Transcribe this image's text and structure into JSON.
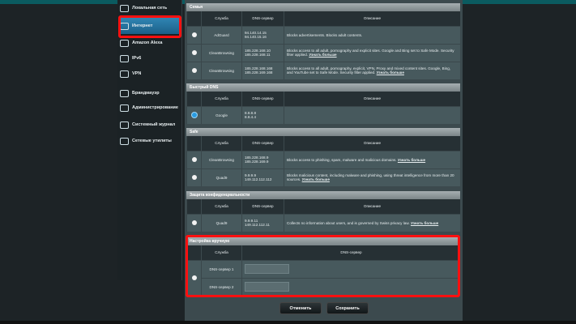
{
  "sidebar": {
    "items": [
      {
        "label": "Локальная сеть",
        "icon": "lan-icon"
      },
      {
        "label": "Интернет",
        "icon": "globe-icon",
        "active": true
      },
      {
        "label": "Amazon Alexa",
        "icon": "alexa-icon"
      },
      {
        "label": "IPv6",
        "icon": "ipv6-icon"
      },
      {
        "label": "VPN",
        "icon": "vpn-icon"
      },
      {
        "label": "Брандмауэр",
        "icon": "firewall-icon"
      },
      {
        "label": "Администрирование",
        "icon": "admin-icon"
      },
      {
        "label": "Системный журнал",
        "icon": "log-icon"
      },
      {
        "label": "Сетевые утилиты",
        "icon": "tools-icon"
      }
    ]
  },
  "cols": {
    "service": "Служба",
    "dns": "DNS-сервер",
    "desc": "Описание"
  },
  "more": "Узнать больше",
  "sections": [
    {
      "title": "Семья",
      "rows": [
        {
          "service": "AdGuard",
          "dns1": "94.140.14.15",
          "dns2": "94.140.15.16",
          "desc": "Blocks advertisements. Blocks adult contents.",
          "more": false
        },
        {
          "service": "CleanBrowsing",
          "dns1": "185.228.168.10",
          "dns2": "185.228.168.11",
          "desc": "Blocks access to all adult, pornography and explicit sites. Google and Bing set to Safe Mode. Security filter applied.",
          "more": true
        },
        {
          "service": "CleanBrowsing",
          "dns1": "185.228.168.168",
          "dns2": "185.228.169.168",
          "desc": "Blocks access to all adult, pornography, explicit, VPN, Proxy and mixed content sites. Google, Bing, and YouTube set to Safe Mode. Security filter applied.",
          "more": true
        }
      ]
    },
    {
      "title": "Быстрый DNS",
      "rows": [
        {
          "service": "Google",
          "dns1": "8.8.8.8",
          "dns2": "8.8.4.4",
          "desc": "",
          "more": false,
          "selected": true
        }
      ]
    },
    {
      "title": "Safe",
      "rows": [
        {
          "service": "CleanBrowsing",
          "dns1": "185.228.168.9",
          "dns2": "185.228.169.9",
          "desc": "Blocks access to phishing, spam, malware and malicious domains.",
          "more": true
        },
        {
          "service": "Quad9",
          "dns1": "9.9.9.9",
          "dns2": "149.112.112.112",
          "desc": "Blocks malicious content, including malware and phishing, using threat intelligence from more than 20 sources.",
          "more": true
        }
      ]
    },
    {
      "title": "Защита конфиденциальности",
      "rows": [
        {
          "service": "Quad9",
          "dns1": "9.9.9.11",
          "dns2": "149.112.112.11",
          "desc": "Collects no information about users, and is governed by Swiss privacy law.",
          "more": true
        }
      ]
    }
  ],
  "manual": {
    "title": "Настройка вручную",
    "dns1_label": "DNS-сервер 1",
    "dns2_label": "DNS-сервер 2",
    "dns1_value": "",
    "dns2_value": ""
  },
  "buttons": {
    "cancel": "Отменить",
    "save": "Сохранить"
  }
}
